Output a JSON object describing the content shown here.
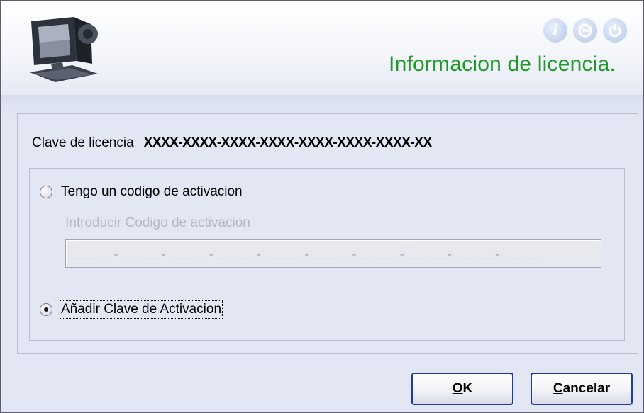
{
  "dialog": {
    "title": "Informacion de licencia.",
    "header_icons": [
      "info-icon",
      "minimize-icon",
      "power-icon"
    ]
  },
  "license": {
    "label": "Clave de licencia",
    "key": "XXXX-XXXX-XXXX-XXXX-XXXX-XXXX-XXXX-XX"
  },
  "options": {
    "activation_code_option": {
      "label": "Tengo un codigo de activacion",
      "selected": false
    },
    "enter_code_label": "Introducir Codigo de activacion",
    "code_field_value": "______-______-______-______-______-______-______-______-______-______",
    "add_key_option": {
      "label": "Añadir Clave de Activacion",
      "selected": true
    }
  },
  "buttons": {
    "ok": {
      "accel": "O",
      "rest": "K"
    },
    "cancel": {
      "accel": "C",
      "rest": "ancelar"
    }
  },
  "colors": {
    "title": "#1f9a2a",
    "background": "#e3e7f4",
    "button_border": "#1f3b9b"
  }
}
